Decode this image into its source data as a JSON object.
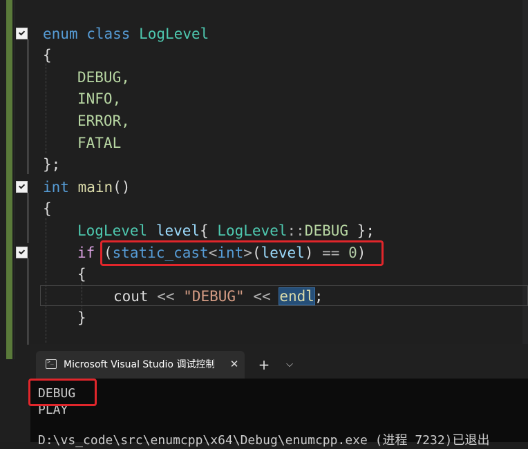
{
  "editor": {
    "lines": {
      "l1": {
        "k1": "enum",
        "k2": "class",
        "name": "LogLevel"
      },
      "l2": {
        "brace": "{"
      },
      "l3": {
        "text": "DEBUG,"
      },
      "l4": {
        "text": "INFO,"
      },
      "l5": {
        "text": "ERROR,"
      },
      "l6": {
        "text": "FATAL"
      },
      "l7": {
        "brace": "};"
      },
      "l8": {
        "type": "int",
        "func": "main",
        "parens": "()"
      },
      "l9": {
        "brace": "{"
      },
      "l10": {
        "type": "LogLevel",
        "var": "level",
        "open": "{",
        "enumType": "LogLevel",
        "scope": "::",
        "member": "DEBUG",
        "close": "};"
      },
      "l11": {
        "kw": "if",
        "p1": "(",
        "cast": "static_cast",
        "lt": "<",
        "castType": "int",
        "gt": ">",
        "p2": "(",
        "var": "level",
        "p3": ")",
        "eq": "==",
        "num": "0",
        "p4": ")"
      },
      "l12": {
        "brace": "{"
      },
      "l13": {
        "cout": "cout",
        "op1": "<<",
        "str": "\"DEBUG\"",
        "op2": "<<",
        "endl": "endl",
        "semi": ";"
      },
      "l14": {
        "brace": "}"
      }
    }
  },
  "terminal": {
    "tab_title": "Microsoft Visual Studio 调试控制台",
    "close_glyph": "✕",
    "new_tab_glyph": "+",
    "dropdown_glyph": "⌵",
    "output": [
      "DEBUG",
      "PLAY",
      "D:\\vs_code\\src\\enumcpp\\x64\\Debug\\enumcpp.exe (进程 7232)已退出"
    ]
  },
  "colors": {
    "annotation": "#e0262b",
    "change_bar": "#5a7a3a",
    "selection": "#264f78"
  }
}
